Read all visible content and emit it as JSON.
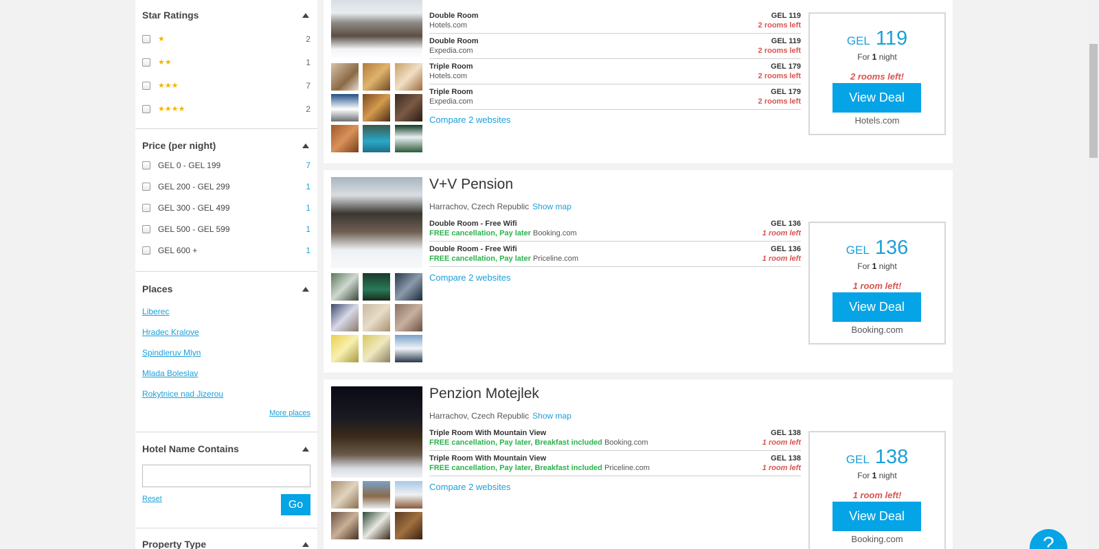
{
  "sidebar": {
    "star_ratings": {
      "title": "Star Ratings",
      "items": [
        {
          "stars": "★",
          "count": "2"
        },
        {
          "stars": "★★",
          "count": "1"
        },
        {
          "stars": "★★★",
          "count": "7"
        },
        {
          "stars": "★★★★",
          "count": "2"
        }
      ]
    },
    "price": {
      "title": "Price (per night)",
      "items": [
        {
          "label": "GEL 0 - GEL 199",
          "count": "7"
        },
        {
          "label": "GEL 200 - GEL 299",
          "count": "1"
        },
        {
          "label": "GEL 300 - GEL 499",
          "count": "1"
        },
        {
          "label": "GEL 500 - GEL 599",
          "count": "1"
        },
        {
          "label": "GEL 600 +",
          "count": "1"
        }
      ]
    },
    "places": {
      "title": "Places",
      "items": [
        "Liberec",
        "Hradec Kralove",
        "Spindleruv Mlyn",
        "Mlada Boleslav",
        "Rokytnice nad Jizerou"
      ],
      "more": "More places"
    },
    "hotel_name": {
      "title": "Hotel Name Contains",
      "value": "",
      "reset": "Reset",
      "go": "Go"
    },
    "property_type": {
      "title": "Property Type"
    }
  },
  "hotels": [
    {
      "deals": [
        {
          "room": "Double Room",
          "free": "",
          "provider": "Hotels.com",
          "price": "GEL 119",
          "left": "2 rooms left"
        },
        {
          "room": "Double Room",
          "free": "",
          "provider": "Expedia.com",
          "price": "GEL 119",
          "left": "2 rooms left"
        },
        {
          "room": "Triple Room",
          "free": "",
          "provider": "Hotels.com",
          "price": "GEL 179",
          "left": "2 rooms left"
        },
        {
          "room": "Triple Room",
          "free": "",
          "provider": "Expedia.com",
          "price": "GEL 179",
          "left": "2 rooms left"
        }
      ],
      "compare": "Compare 2 websites",
      "best": {
        "currency": "GEL",
        "amount": "119",
        "for_pre": "For ",
        "nights": "1",
        "for_post": " night",
        "rooms_left": "2 rooms left!",
        "button": "View Deal",
        "site": "Hotels.com"
      }
    },
    {
      "name": "V+V Pension",
      "location": "Harrachov, Czech Republic",
      "show_map": "Show map",
      "deals": [
        {
          "room": "Double Room - Free Wifi",
          "free": "FREE cancellation, Pay later",
          "provider": "Booking.com",
          "price": "GEL 136",
          "left": "1 room left"
        },
        {
          "room": "Double Room - Free Wifi",
          "free": "FREE cancellation, Pay later",
          "provider": "Priceline.com",
          "price": "GEL 136",
          "left": "1 room left"
        }
      ],
      "compare": "Compare 2 websites",
      "best": {
        "currency": "GEL",
        "amount": "136",
        "for_pre": "For ",
        "nights": "1",
        "for_post": " night",
        "rooms_left": "1 room left!",
        "button": "View Deal",
        "site": "Booking.com"
      }
    },
    {
      "name": "Penzion Motejlek",
      "location": "Harrachov, Czech Republic",
      "show_map": "Show map",
      "deals": [
        {
          "room": "Triple Room With Mountain View",
          "free": "FREE cancellation, Pay later, Breakfast included",
          "provider": "Booking.com",
          "price": "GEL 138",
          "left": "1 room left"
        },
        {
          "room": "Triple Room With Mountain View",
          "free": "FREE cancellation, Pay later, Breakfast included",
          "provider": "Priceline.com",
          "price": "GEL 138",
          "left": "1 room left"
        }
      ],
      "compare": "Compare 2 websites",
      "best": {
        "currency": "GEL",
        "amount": "138",
        "for_pre": "For ",
        "nights": "1",
        "for_post": " night",
        "rooms_left": "1 room left!",
        "button": "View Deal",
        "site": "Booking.com"
      }
    }
  ],
  "help": "?"
}
